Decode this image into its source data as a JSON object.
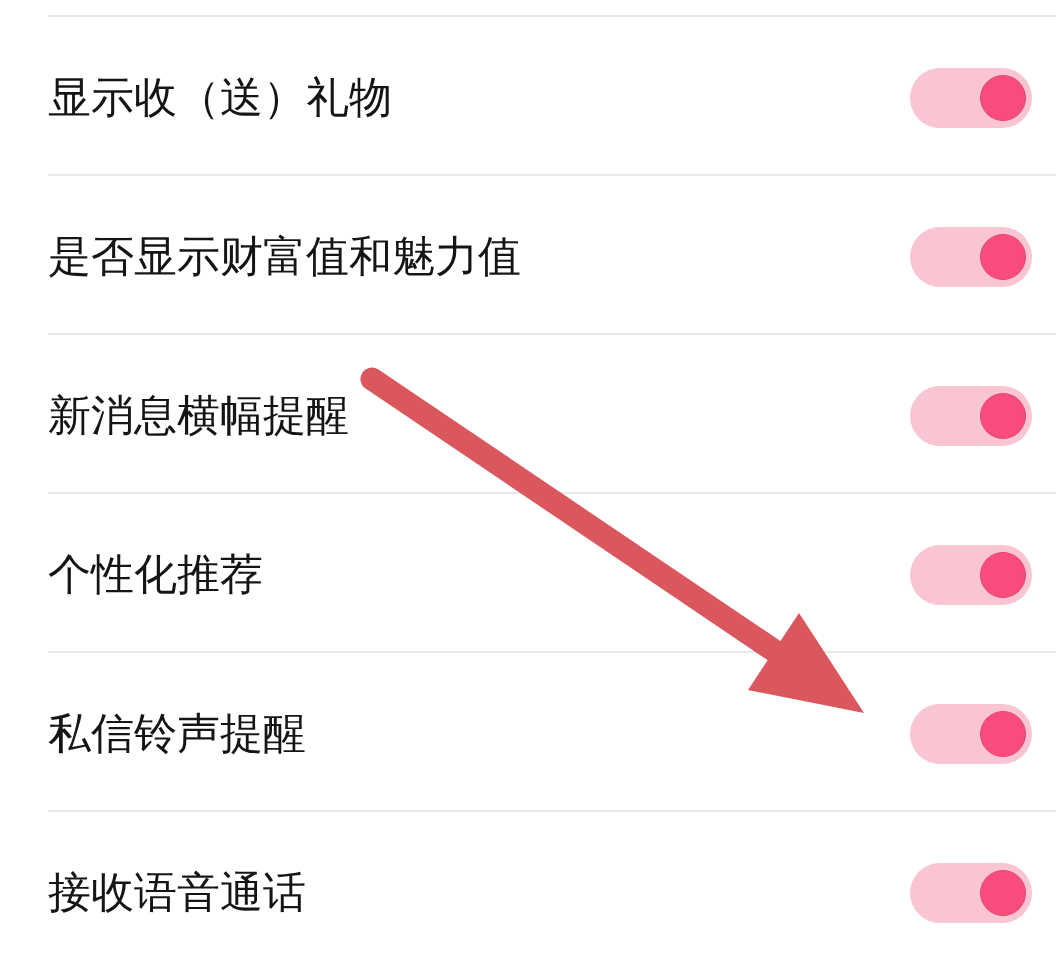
{
  "settings": [
    {
      "label": "显示收（送）礼物",
      "on": true
    },
    {
      "label": "是否显示财富值和魅力值",
      "on": true
    },
    {
      "label": "新消息横幅提醒",
      "on": true
    },
    {
      "label": "个性化推荐",
      "on": true
    },
    {
      "label": "私信铃声提醒",
      "on": true
    },
    {
      "label": "接收语音通话",
      "on": true
    }
  ],
  "annotations": [
    {
      "kind": "arrow"
    }
  ]
}
